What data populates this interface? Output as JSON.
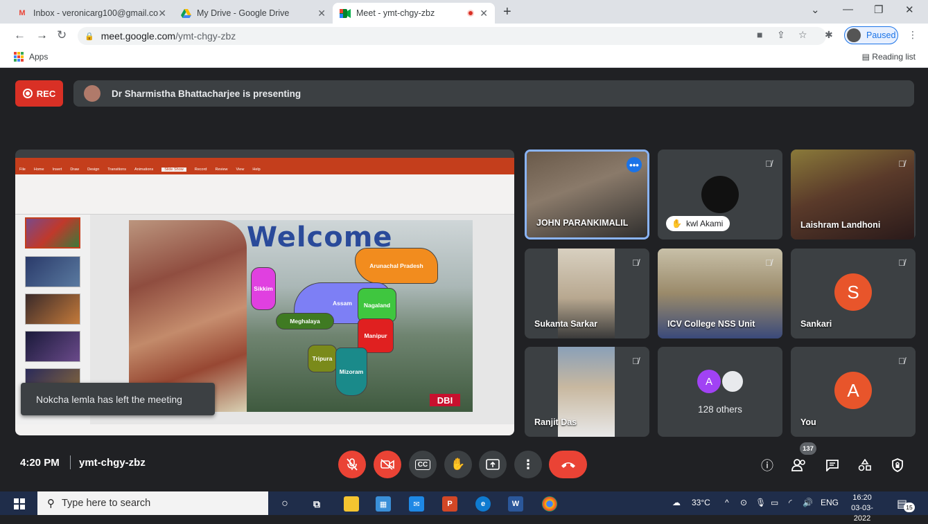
{
  "browser": {
    "tabs": [
      {
        "label": "Inbox - veronicarg100@gmail.co",
        "icon": "gmail-icon"
      },
      {
        "label": "My Drive - Google Drive",
        "icon": "drive-icon"
      },
      {
        "label": "Meet - ymt-chgy-zbz",
        "icon": "meet-icon",
        "active": true
      }
    ],
    "url_host": "meet.google.com",
    "url_path": "/ymt-chgy-zbz",
    "profile_status": "Paused",
    "bookmarks": {
      "apps_label": "Apps",
      "reading_list": "Reading list"
    }
  },
  "meet": {
    "rec_label": "REC",
    "presenting_text": "Dr Sharmistha Bhattacharjee is presenting",
    "slide": {
      "title": "Welcome",
      "states": [
        "Arunachal Pradesh",
        "Sikkim",
        "Assam",
        "Nagaland",
        "Meghalaya",
        "Manipur",
        "Tripura",
        "Mizoram"
      ],
      "logo": "DBI"
    },
    "toast": "Nokcha lemla has left the meeting",
    "participants": [
      {
        "name": "JOHN PARANKIMALIL",
        "speaking": true
      },
      {
        "name": "kwl Akami"
      },
      {
        "name": "Laishram Landhoni"
      },
      {
        "name": "Sukanta Sarkar"
      },
      {
        "name": "ICV College NSS Unit"
      },
      {
        "name": "Sankari",
        "initial": "S"
      },
      {
        "name": "Ranjit Das"
      },
      {
        "name": "128 others",
        "initial": "A"
      },
      {
        "name": "You",
        "initial": "A"
      }
    ],
    "bottom": {
      "time": "4:20 PM",
      "code": "ymt-chgy-zbz",
      "participant_count": "137"
    }
  },
  "taskbar": {
    "search_placeholder": "Type here to search",
    "weather": "33°C",
    "lang": "ENG",
    "time": "16:20",
    "date": "03-03-2022",
    "notifications": "15"
  },
  "colors": {
    "accent": "#1a73e8",
    "danger": "#ea4335",
    "meet_bg": "#202124",
    "tile_bg": "#3c4043"
  }
}
